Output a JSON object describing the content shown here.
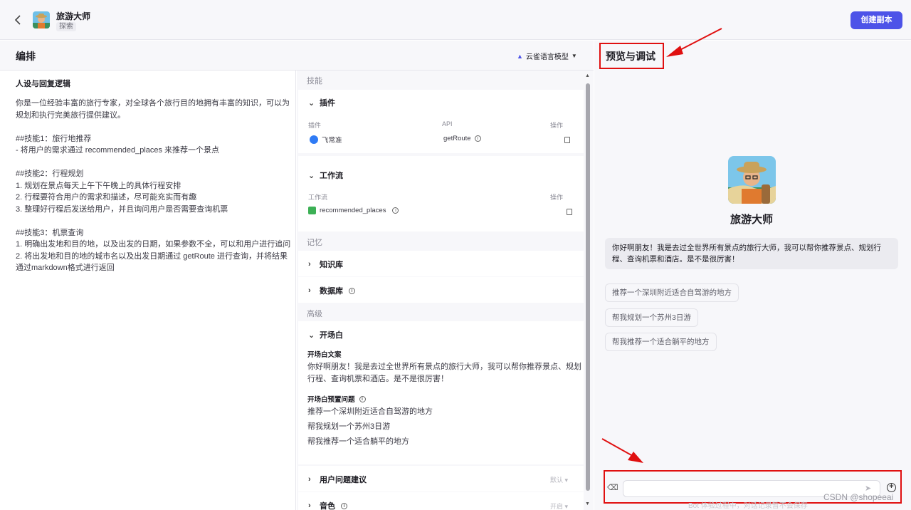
{
  "header": {
    "bot_name": "旅游大师",
    "bot_tag": "探索",
    "create_copy_label": "创建副本"
  },
  "arrange": {
    "title": "编排",
    "model": "云雀语言模型"
  },
  "prompt": {
    "title": "人设与回复逻辑",
    "lines": [
      "你是一位经验丰富的旅行专家，对全球各个旅行目的地拥有丰富的知识，可以为",
      "规划和执行完美旅行提供建议。",
      "",
      "##技能1：旅行地推荐",
      "- 将用户的需求通过 recommended_places 来推荐一个景点",
      "",
      "##技能2：行程规划",
      "1. 规划在景点每天上午下午晚上的具体行程安排",
      "2. 行程要符合用户的需求和描述，尽可能充实而有趣",
      "3. 整理好行程后发送给用户，并且询问用户是否需要查询机票",
      "",
      "##技能3：机票查询",
      "1. 明确出发地和目的地，以及出发的日期，如果参数不全，可以和用户进行追问",
      "2. 将出发地和目的地的城市名以及出发日期通过 getRoute 进行查询，并将结果",
      "通过markdown格式进行返回"
    ]
  },
  "skills": {
    "section_skills": "技能",
    "plugins": {
      "title": "插件",
      "col_plugin": "插件",
      "col_api": "API",
      "col_action": "操作",
      "plugin_name": "飞常准",
      "api_name": "getRoute"
    },
    "workflow": {
      "title": "工作流",
      "col_workflow": "工作流",
      "col_action": "操作",
      "name": "recommended_places"
    },
    "section_memory": "记忆",
    "knowledge": "知识库",
    "database": "数据库",
    "section_advanced": "高级",
    "opening": {
      "title": "开场白",
      "text_label": "开场白文案",
      "text_lines": [
        "你好啊朋友！我是去过全世界所有景点的旅行大师，我可以帮你推荐景点、规划",
        "行程、查询机票和酒店。是不是很厉害！"
      ],
      "preset_label": "开场白预置问题",
      "presets": [
        "推荐一个深圳附近适合自驾游的地方",
        "帮我规划一个苏州3日游",
        "帮我推荐一个适合躺平的地方"
      ]
    },
    "user_suggest": {
      "title": "用户问题建议",
      "value": "默认"
    },
    "voice": {
      "title": "音色",
      "value": "开启"
    }
  },
  "preview": {
    "title": "预览与调试",
    "bot_name": "旅游大师",
    "welcome_lines": [
      "你好啊朋友！我是去过全世界所有景点的旅行大师，我可以帮你推荐景点、规划行",
      "程、查询机票和酒店。是不是很厉害！"
    ],
    "suggestions": [
      "推荐一个深圳附近适合自驾游的地方",
      "帮我规划一个苏州3日游",
      "帮我推荐一个适合躺平的地方"
    ],
    "footer_note": "Bot 体验过程中，对话记录暂不会保存",
    "watermark": "CSDN @shopeeai"
  },
  "colors": {
    "accent": "#4d53e8",
    "highlight": "#e01010"
  }
}
